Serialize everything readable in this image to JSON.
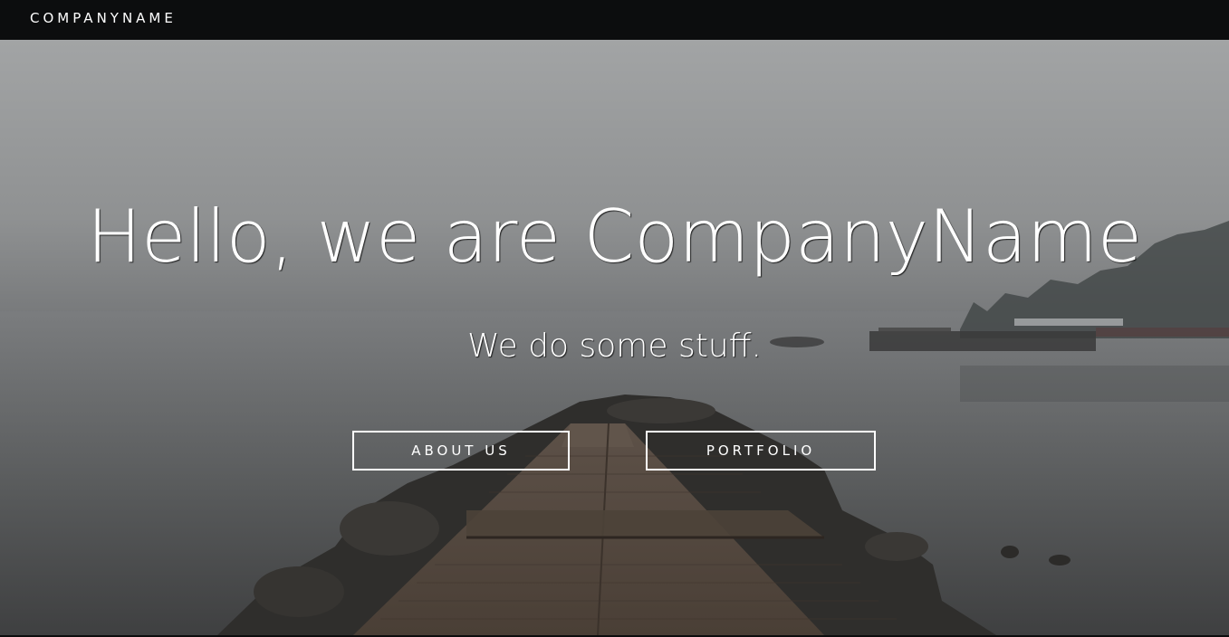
{
  "navbar": {
    "brand": "COMPANYNAME"
  },
  "hero": {
    "title": "Hello, we are CompanyName",
    "subtitle": "We do some stuff.",
    "buttons": {
      "about_label": "ABOUT US",
      "portfolio_label": "PORTFOLIO"
    },
    "background": "foggy-lake-wooden-pier-photo"
  },
  "colors": {
    "navbar_bg": "#0c0d0e",
    "text": "#ffffff",
    "button_border": "#ffffff"
  }
}
